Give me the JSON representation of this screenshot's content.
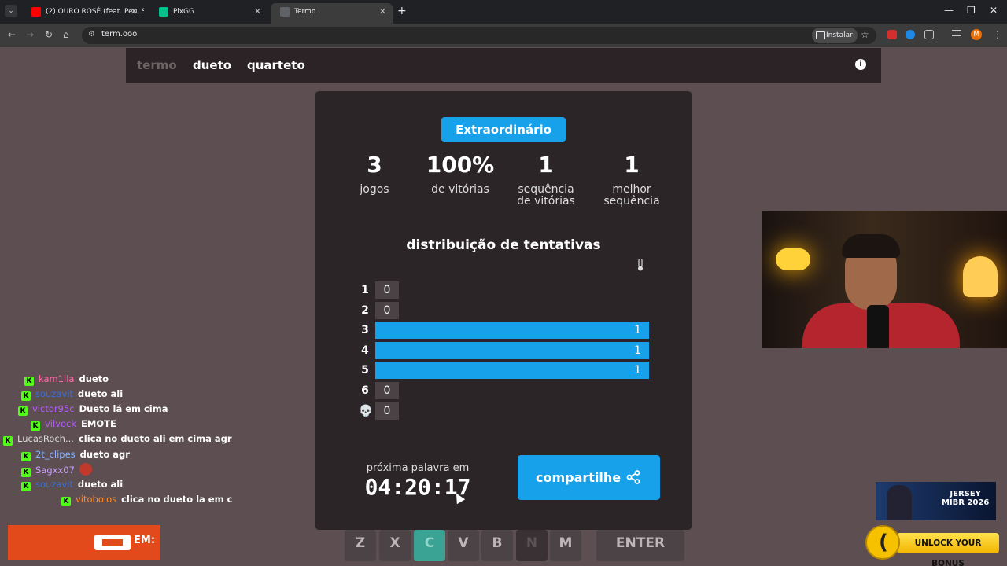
{
  "browser": {
    "tabs": [
      {
        "title": "(2) OURO ROSÉ (feat. Peu, Suet",
        "favicon_color": "#ff0000"
      },
      {
        "title": "PixGG",
        "favicon_color": "#00c08b"
      },
      {
        "title": "Termo",
        "favicon_color": "#5f6368",
        "active": true
      }
    ],
    "url": "term.ooo",
    "install_label": "Instalar",
    "profile_initial": "M"
  },
  "game": {
    "modes": [
      "termo",
      "dueto",
      "quarteto"
    ],
    "active_mode": "termo",
    "info_label": "i"
  },
  "stats_modal": {
    "badge": "Extraordinário",
    "stats": [
      {
        "value": "3",
        "label_lines": [
          "jogos"
        ]
      },
      {
        "value": "100%",
        "label_lines": [
          "de vitórias"
        ]
      },
      {
        "value": "1",
        "label_lines": [
          "sequência",
          "de vitórias"
        ]
      },
      {
        "value": "1",
        "label_lines": [
          "melhor",
          "sequência"
        ]
      }
    ],
    "distribution_title": "distribuição de tentativas",
    "distribution": [
      {
        "label": "1",
        "count": 0
      },
      {
        "label": "2",
        "count": 0
      },
      {
        "label": "3",
        "count": 1
      },
      {
        "label": "4",
        "count": 1
      },
      {
        "label": "5",
        "count": 1
      },
      {
        "label": "6",
        "count": 0
      },
      {
        "label": "💀",
        "count": 0
      }
    ],
    "next_word_label": "próxima palavra em",
    "countdown": "04:20:17",
    "share_label": "compartilhe"
  },
  "keyboard_visible": [
    {
      "key": "Z",
      "state": "normal"
    },
    {
      "key": "X",
      "state": "normal"
    },
    {
      "key": "C",
      "state": "hit"
    },
    {
      "key": "V",
      "state": "normal"
    },
    {
      "key": "B",
      "state": "normal"
    },
    {
      "key": "N",
      "state": "absent"
    },
    {
      "key": "M",
      "state": "normal"
    },
    {
      "key": "ENTER",
      "state": "normal"
    }
  ],
  "chat": [
    {
      "user": "kam1lla",
      "color": "#ff6aa8",
      "message": "dueto"
    },
    {
      "user": "souzavit",
      "color": "#3b6fd9",
      "message": "dueto ali"
    },
    {
      "user": "victor95c",
      "color": "#b45cff",
      "message": "Dueto lá em cima"
    },
    {
      "user": "vilvock",
      "color": "#b45cff",
      "message": "EMOTE"
    },
    {
      "user": "LucasRoch...",
      "color": "#d9d9d9",
      "message": "clica no dueto ali em cima agr"
    },
    {
      "user": "2t_clipes",
      "color": "#8ab4ff",
      "message": "dueto agr"
    },
    {
      "user": "Sagxx07",
      "color": "#c8a0ff",
      "message": ""
    },
    {
      "user": "souzavit",
      "color": "#3b6fd9",
      "message": "dueto ali"
    },
    {
      "user": "vitobolos",
      "color": "#ff8c2a",
      "message": "clica no dueto la em c"
    }
  ],
  "overlay_bottom_left": {
    "label": "EM:"
  },
  "ads": {
    "jersey_lines": [
      "JERSEY",
      "MIBR 2026"
    ],
    "bonus_label": "UNLOCK YOUR BONUS"
  }
}
